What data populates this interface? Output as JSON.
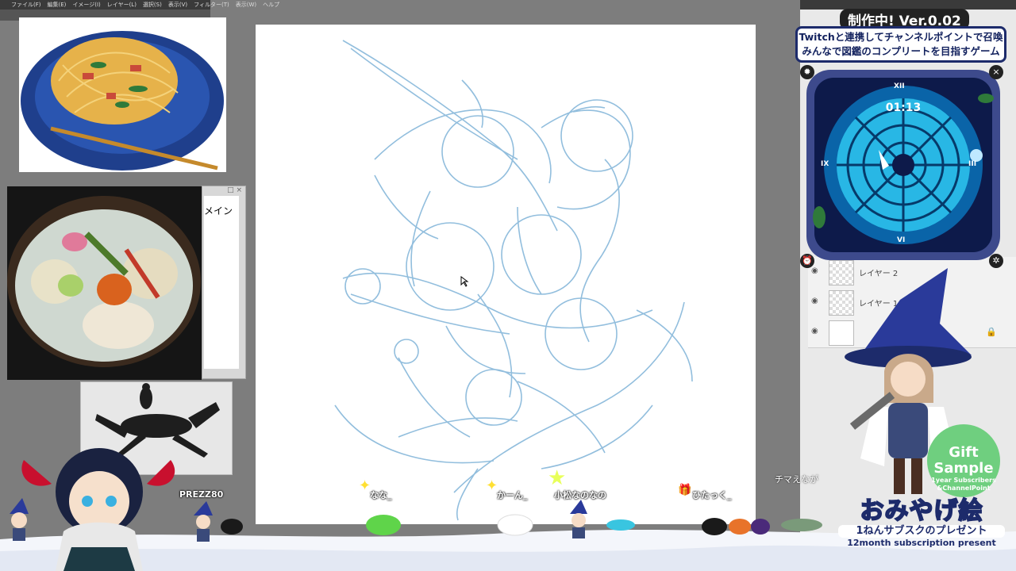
{
  "app": {
    "menu": [
      "ファイル(F)",
      "編集(E)",
      "イメージ(I)",
      "レイヤー(L)",
      "選択(S)",
      "表示(V)",
      "フィルター(T)",
      "表示(W)",
      "ヘルプ"
    ]
  },
  "sub_window": {
    "label": "メイン"
  },
  "layers": [
    {
      "name": "レイヤー 2"
    },
    {
      "name": "レイヤー 1 のコ"
    },
    {
      "name": ""
    }
  ],
  "overlay": {
    "banner_title": "制作中! Ver.0.02",
    "banner_line1": "Twitchと連携してチャンネルポイントで召喚",
    "banner_line2": "みんなで図鑑のコンプリートを目指すゲーム",
    "clock_time": "01:13",
    "clock_numerals": [
      "XII",
      "III",
      "VI",
      "IX"
    ],
    "close_icon": "×",
    "streamer_tag": "PREZZ80",
    "viewer_names": [
      "なな_",
      "かーん_",
      "小松なのなの",
      "ひたっく_"
    ],
    "chat_name": "チマえなが",
    "gift": {
      "line1": "Gift",
      "line2": "Sample",
      "line3": "1year Subscribers",
      "line4": "&ChannelPoint"
    },
    "promo": {
      "title": "おみやげ絵",
      "subtitle": "1ねんサブスクのプレゼント",
      "english": "12month subscription present"
    }
  },
  "colors": {
    "sketch_blue": "#7fb3d8",
    "banner_navy": "#1d2b6b",
    "clock_cyan": "#2ec5f0",
    "background_gray": "#7d7d7d"
  }
}
